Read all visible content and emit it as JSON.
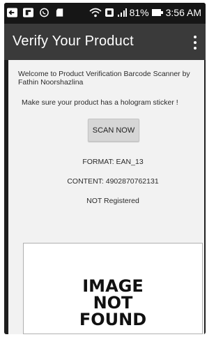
{
  "status_bar": {
    "battery_percent": "81%",
    "time": "3:56 AM",
    "icons": [
      "back-arrow-icon",
      "flipboard-icon",
      "whatsapp-icon",
      "sd-card-icon",
      "wifi-icon",
      "data-saver-icon",
      "signal-icon",
      "battery-icon"
    ]
  },
  "app_bar": {
    "title": "Verify Your Product",
    "menu_icon": "overflow-menu-icon"
  },
  "main": {
    "welcome_text": "Welcome to Product Verification Barcode Scanner by Fathin Noorshazlina",
    "hint_text": "Make sure your product has a hologram sticker !",
    "scan_button_label": "SCAN NOW",
    "format_text": "FORMAT: EAN_13",
    "content_text": "CONTENT: 4902870762131",
    "registration_status": "NOT Registered",
    "image_placeholder": {
      "line1": "IMAGE",
      "line2": "NOT",
      "line3": "FOUND"
    }
  }
}
